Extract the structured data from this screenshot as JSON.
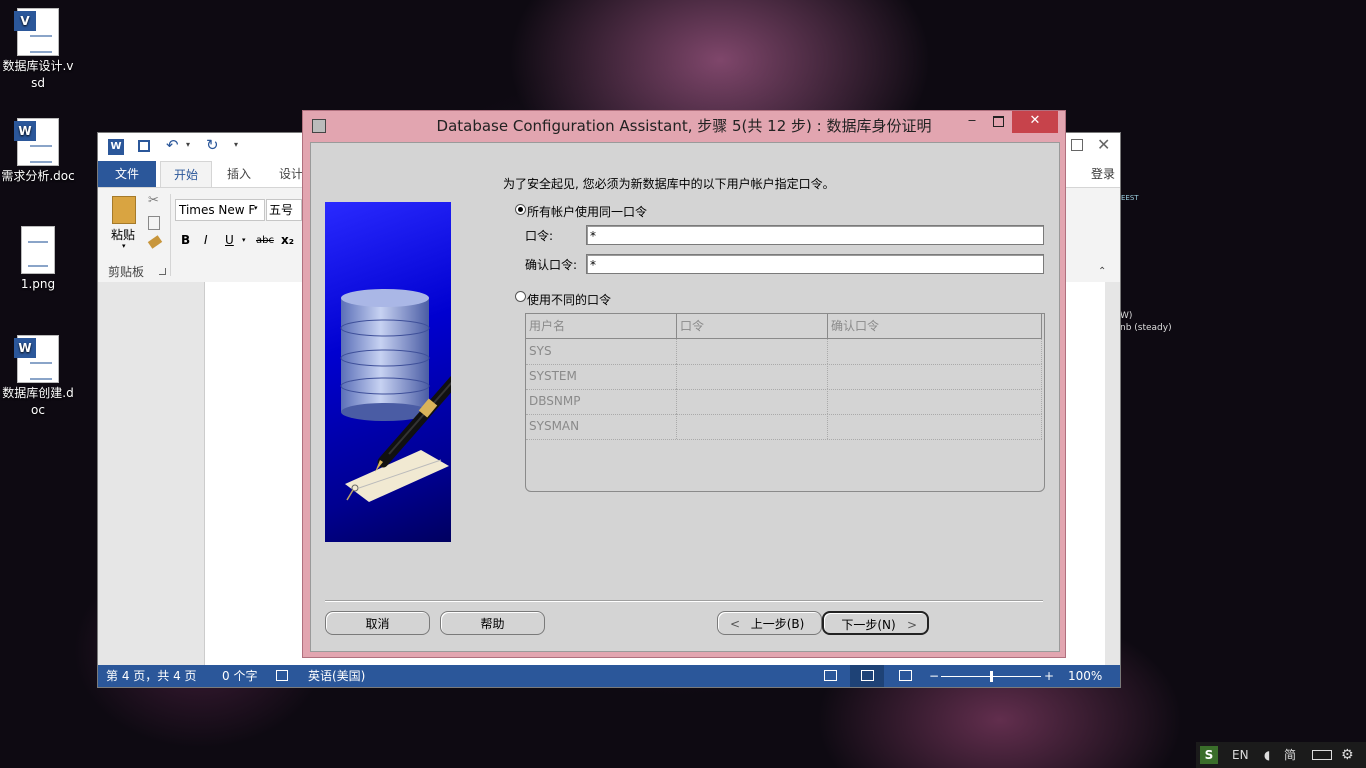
{
  "desktop": {
    "icons": [
      {
        "label": "数据库设计.vsd",
        "badge": "V"
      },
      {
        "label": "需求分析.doc",
        "badge": "W"
      },
      {
        "label": "1.png",
        "badge": ""
      },
      {
        "label": "数据库创建.doc",
        "badge": "W"
      }
    ],
    "bg_text_1": "W)",
    "bg_text_2": "nb (steady)",
    "bg_text_3": "EEST"
  },
  "word": {
    "tabs": [
      "文件",
      "开始",
      "插入",
      "设计"
    ],
    "login": "登录",
    "font_name": "Times New F",
    "font_size": "五号",
    "paste": "粘贴",
    "clipboard": "剪贴板",
    "format_buttons": [
      "B",
      "I",
      "U",
      "abc",
      "x₂"
    ],
    "status": {
      "page": "第 4 页，共 4 页",
      "words": "0 个字",
      "language": "英语(美国)",
      "zoom": "100%",
      "zoom_level": 0.5
    }
  },
  "dialog": {
    "title": "Database Configuration Assistant, 步骤 5(共 12 步) : 数据库身份证明",
    "instruction": "为了安全起见, 您必须为新数据库中的以下用户帐户指定口令。",
    "radio_same": "所有帐户使用同一口令",
    "radio_same_selected": true,
    "password_label": "口令:",
    "password_value": "*",
    "confirm_label": "确认口令:",
    "confirm_value": "*",
    "radio_diff": "使用不同的口令",
    "radio_diff_selected": false,
    "table": {
      "columns": [
        "用户名",
        "口令",
        "确认口令"
      ],
      "rows": [
        [
          "SYS",
          "",
          ""
        ],
        [
          "SYSTEM",
          "",
          ""
        ],
        [
          "DBSNMP",
          "",
          ""
        ],
        [
          "SYSMAN",
          "",
          ""
        ]
      ]
    },
    "buttons": {
      "cancel": "取消",
      "help": "帮助",
      "back": "上一步(B)",
      "next": "下一步(N)"
    }
  },
  "tray": {
    "items": [
      "S",
      "EN",
      "简"
    ]
  },
  "colors": {
    "word_accent": "#2b579a",
    "dialog_frame": "#e2a5b0",
    "dialog_body": "#d4d4d4",
    "close_red": "#c7434b"
  }
}
